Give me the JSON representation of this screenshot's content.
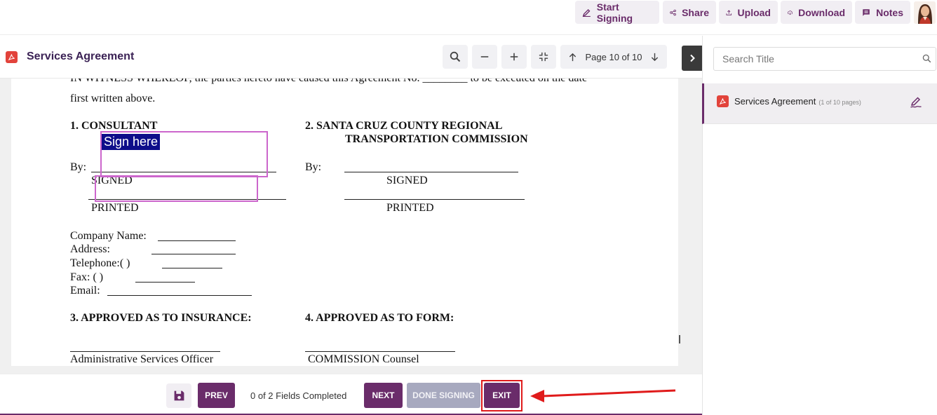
{
  "toolbar": {
    "start_signing": "Start Signing",
    "share": "Share",
    "upload": "Upload",
    "download": "Download",
    "notes": "Notes"
  },
  "document": {
    "title": "Services Agreement",
    "page_indicator": "Page 10 of 10"
  },
  "page_content": {
    "witness_line1": "IN WITNESS WHEREOF, the parties hereto have caused this Agreement No. ________ to be executed on the date",
    "witness_line2": "first written above.",
    "consultant_heading": "1.  CONSULTANT",
    "sccrtc_heading_1": "2.  SANTA CRUZ COUNTY REGIONAL",
    "sccrtc_heading_2": "TRANSPORTATION COMMISSION",
    "by_label_left": "By:",
    "by_label_right": "By:",
    "signed_left": "SIGNED",
    "signed_right": "SIGNED",
    "printed_left": "PRINTED",
    "printed_right": "PRINTED",
    "company_name": "Company Name:",
    "address": "Address:",
    "telephone": "Telephone:(         )",
    "fax": "Fax: (         )",
    "email": "Email:",
    "insurance_heading": "3. APPROVED AS TO INSURANCE:",
    "form_heading": "4. APPROVED AS TO FORM:",
    "admin_officer": "Administrative Services Officer",
    "commission_counsel": "COMMISSION Counsel"
  },
  "sign_field": {
    "label": "Sign here"
  },
  "bottom_bar": {
    "prev": "PREV",
    "fields_completed": "0 of 2 Fields Completed",
    "next": "NEXT",
    "done_signing": "DONE SIGNING",
    "exit": "EXIT"
  },
  "sidebar": {
    "search_placeholder": "Search Title",
    "doc_item": {
      "name": "Services Agreement",
      "pages": "(1 of 10 pages)"
    }
  },
  "colors": {
    "brand": "#6a2c6a",
    "pdf_red": "#e2433b",
    "sign_field_border": "#cc66cc",
    "sign_here_bg": "#0d0d8a",
    "highlight_red": "#e01b1b",
    "disabled_button": "#a7a9bf"
  },
  "icons": [
    "pen-icon",
    "share-icon",
    "upload-icon",
    "download-cloud-icon",
    "notes-icon",
    "pdf-icon",
    "search-icon",
    "minus-icon",
    "plus-icon",
    "fit-icon",
    "arrow-up-icon",
    "arrow-down-icon",
    "chevron-right-icon",
    "save-icon",
    "edit-sign-icon"
  ]
}
